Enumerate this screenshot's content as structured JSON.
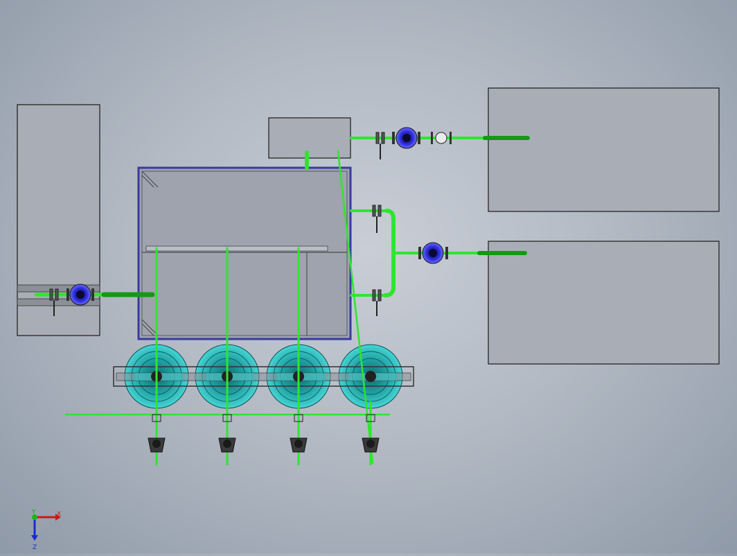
{
  "app": {
    "view": "Top",
    "background_color": "#b8bec8"
  },
  "colors": {
    "pipe": "#2ee62e",
    "pipe_dark": "#139a13",
    "equipment_fill": "#a9adb6",
    "equipment_edge": "#222222",
    "tank_frame": "#3a3aa0",
    "pump_body": "#1f9f9f",
    "pump_ring": "#3ad2d2",
    "meter_blue": "#2a2ad8"
  },
  "triad": {
    "x_label": "X",
    "y_label": "Y",
    "z_label": "Z"
  },
  "pumps": {
    "count": 4
  }
}
